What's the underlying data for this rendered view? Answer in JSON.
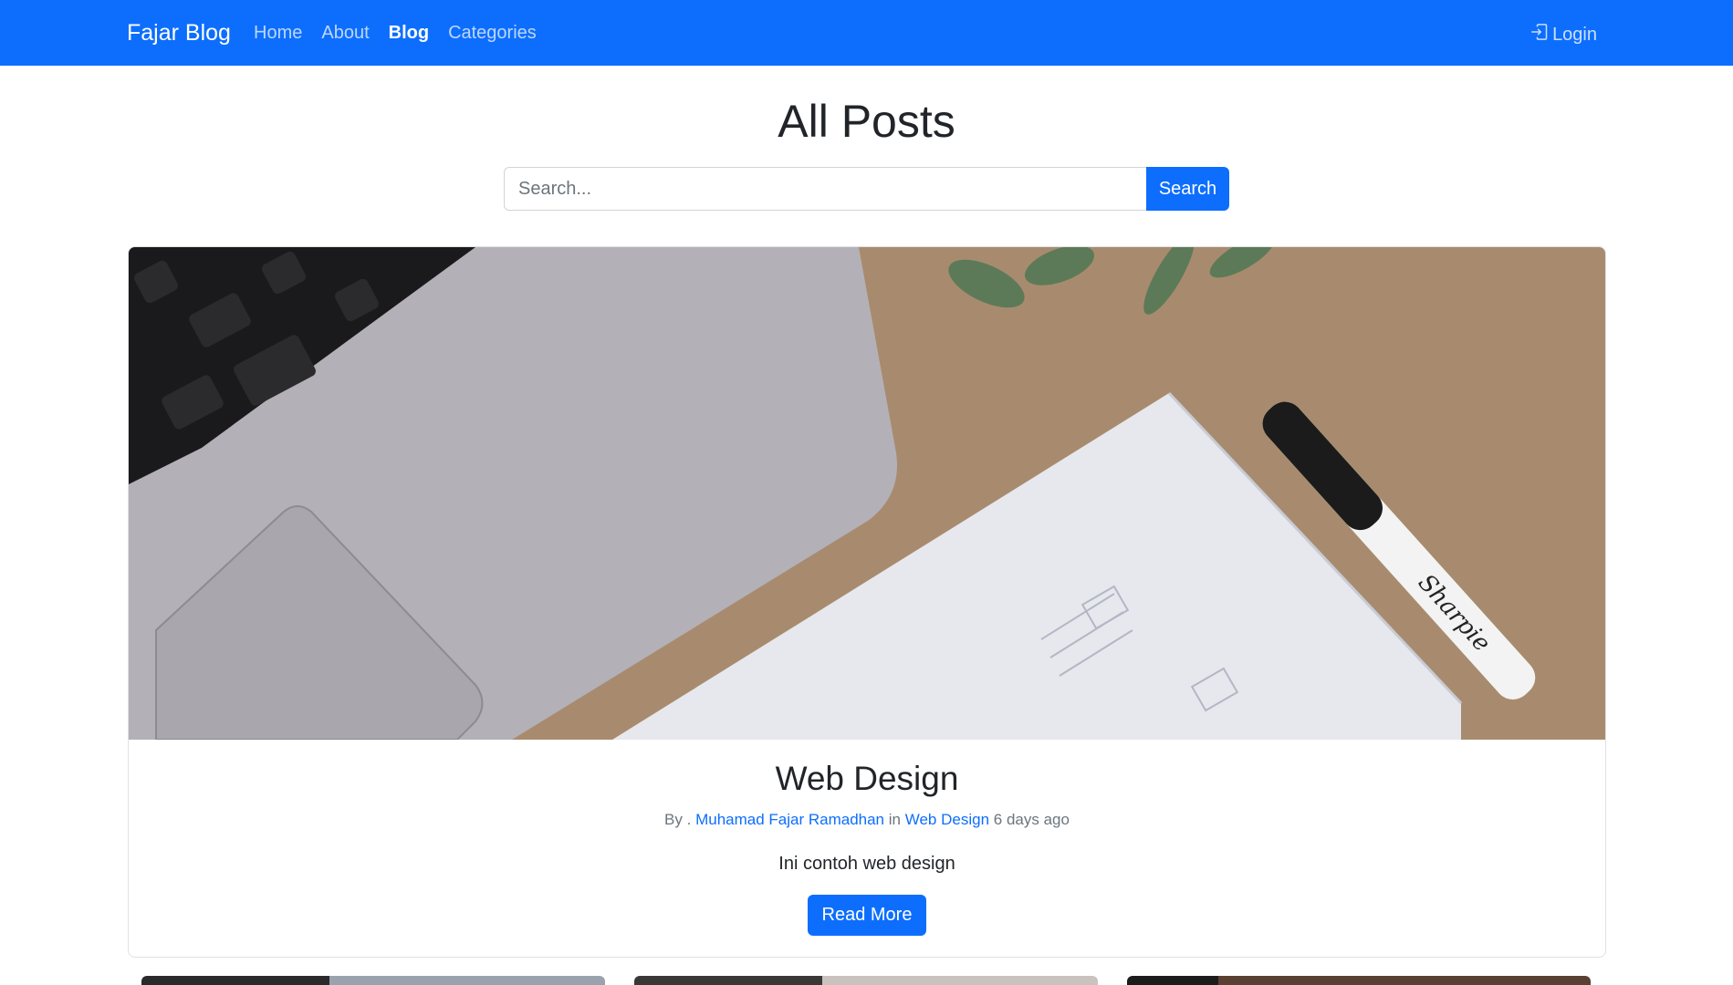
{
  "navbar": {
    "brand": "Fajar Blog",
    "links": [
      {
        "label": "Home",
        "active": false
      },
      {
        "label": "About",
        "active": false
      },
      {
        "label": "Blog",
        "active": true
      },
      {
        "label": "Categories",
        "active": false
      }
    ],
    "login_label": "Login",
    "login_icon": "login-icon"
  },
  "main": {
    "title": "All Posts",
    "search": {
      "placeholder": "Search...",
      "value": "",
      "button_label": "Search"
    }
  },
  "featured_post": {
    "title": "Web Design",
    "by_label": "By .",
    "author": "Muhamad Fajar Ramadhan",
    "in_label": "in",
    "category": "Web Design",
    "time": "6 days ago",
    "excerpt": "Ini contoh web design",
    "read_more_label": "Read More"
  },
  "colors": {
    "primary": "#0d6efd",
    "text": "#212529",
    "muted": "#6c757d"
  }
}
